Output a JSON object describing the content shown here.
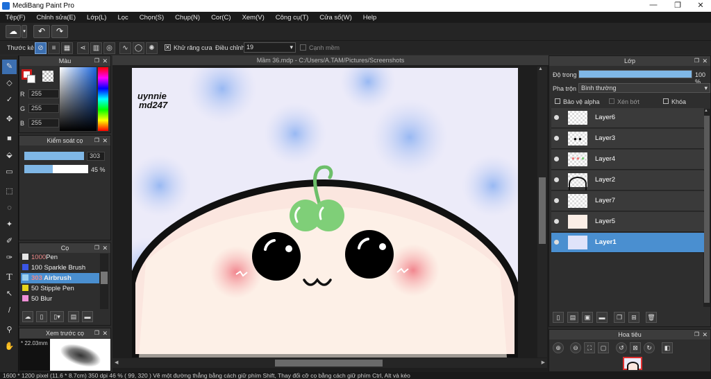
{
  "window": {
    "title": "MediBang Paint Pro",
    "minimize": "—",
    "maximize": "❐",
    "close": "✕"
  },
  "menu": [
    "Tệp(F)",
    "Chỉnh sửa(E)",
    "Lớp(L)",
    "Lọc",
    "Chọn(S)",
    "Chụp(N)",
    "Cor(C)",
    "Xem(V)",
    "Công cụ(T)",
    "Cửa sổ(W)",
    "Help"
  ],
  "toolbar2": {
    "ruler_label": "Thước kẻ",
    "antialias_label": "Khử răng cưa",
    "adjust_label": "Điều chỉnh",
    "adjust_value": "19",
    "soft_edge_label": "Cạnh mềm"
  },
  "color_panel": {
    "title": "Màu",
    "r_label": "R",
    "g_label": "G",
    "b_label": "B",
    "r": "255",
    "g": "255",
    "b": "255",
    "primary": "#ffffff",
    "secondary": "#cc1b1b"
  },
  "brush_control": {
    "title": "Kiểm soát cọ",
    "size": "303",
    "opacity": "45 %",
    "opacity_value": 45
  },
  "brush_panel": {
    "title": "Cọ",
    "items": [
      {
        "size": "1000",
        "name": "Pen",
        "color": "#e6e6e6"
      },
      {
        "size": "100",
        "name": "Sparkle Brush",
        "color": "#3b56e6"
      },
      {
        "size": "303",
        "name": "Airbrush",
        "color": "#9bd0f0",
        "selected": true
      },
      {
        "size": "50",
        "name": "Stipple Pen",
        "color": "#e6d31b"
      },
      {
        "size": "50",
        "name": "Blur",
        "color": "#f090d8"
      }
    ]
  },
  "preview_panel": {
    "title": "Xem trước cọ",
    "size": "22.03mm"
  },
  "document": {
    "tab": "Mầm 36.mdp - C:/Users/A.TAM/Pictures/Screenshots",
    "signature": "uynnie md247"
  },
  "layer_panel": {
    "title": "Lớp",
    "opacity_label": "Độ trong",
    "opacity_value": "100 %",
    "blend_label": "Pha trộn",
    "blend_value": "Bình thường",
    "protect_alpha": "Bảo vệ alpha",
    "clip": "Xén bớt",
    "lock": "Khóa",
    "layers": [
      {
        "name": "Layer6"
      },
      {
        "name": "Layer3"
      },
      {
        "name": "Layer4"
      },
      {
        "name": "Layer2"
      },
      {
        "name": "Layer7"
      },
      {
        "name": "Layer5"
      },
      {
        "name": "Layer1",
        "selected": true
      }
    ]
  },
  "navigator": {
    "title": "Hoa tiêu"
  },
  "status": "1600 * 1200 pixel   (11.6 * 8.7cm)  350 dpi   46 %   ( 99, 320 )   Vẽ một đường thẳng bằng cách giữ phím Shift, Thay đổi cỡ cọ bằng cách giữ phím Ctrl, Alt và kéo"
}
